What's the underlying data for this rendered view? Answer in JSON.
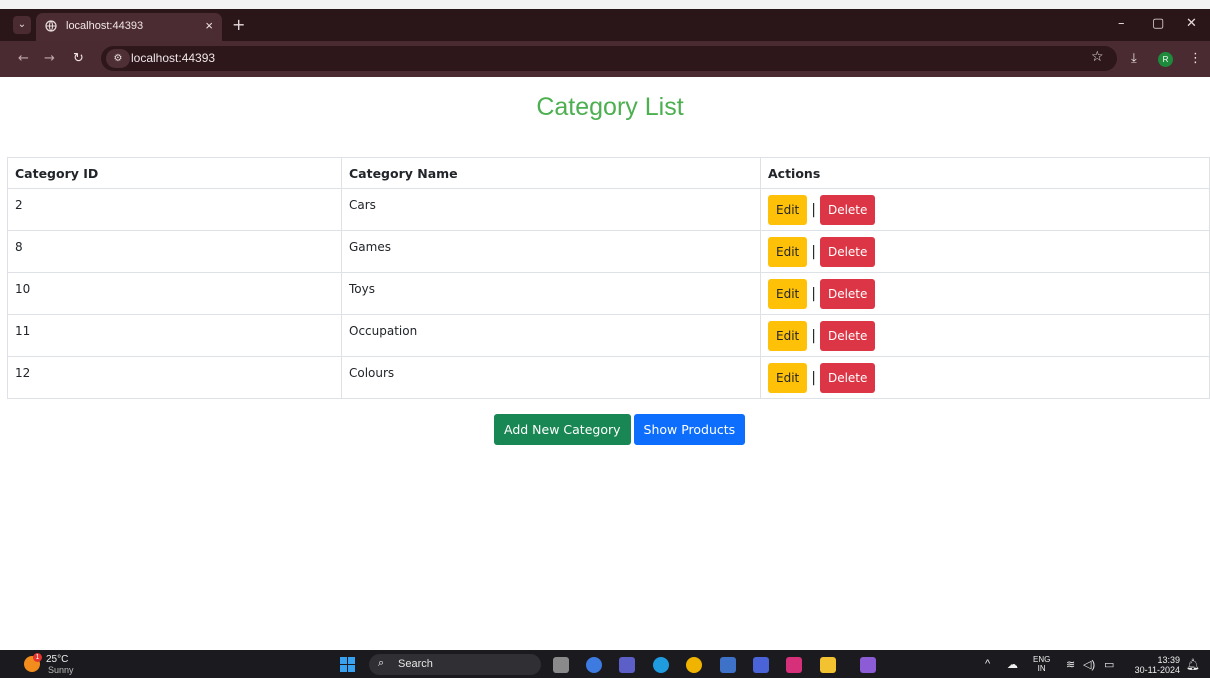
{
  "browser": {
    "tab_title": "localhost:44393",
    "tab_close": "×",
    "new_tab": "+",
    "url": "localhost:44393",
    "window_controls": [
      "–",
      "▢",
      "✕"
    ],
    "profile_initial": "R"
  },
  "page": {
    "title": "Category List",
    "table": {
      "headers": [
        "Category ID",
        "Category Name",
        "Actions"
      ],
      "rows": [
        {
          "id": "2",
          "name": "Cars"
        },
        {
          "id": "8",
          "name": "Games"
        },
        {
          "id": "10",
          "name": "Toys"
        },
        {
          "id": "11",
          "name": "Occupation"
        },
        {
          "id": "12",
          "name": "Colours"
        }
      ],
      "edit_label": "Edit",
      "separator": "|",
      "delete_label": "Delete"
    },
    "add_button": "Add New Category",
    "show_products_button": "Show Products"
  },
  "taskbar": {
    "weather_temp": "25°C",
    "weather_condition": "Sunny",
    "weather_badge": "1",
    "search_placeholder": "Search",
    "lang_top": "ENG",
    "lang_bottom": "IN",
    "time": "13:39",
    "date": "30-11-2024"
  },
  "colors": {
    "title_green": "#4caf50",
    "edit_yellow": "#ffc107",
    "delete_red": "#dc3545",
    "add_green": "#198754",
    "show_blue": "#0d6efd",
    "chrome_dark": "#2a1519"
  }
}
